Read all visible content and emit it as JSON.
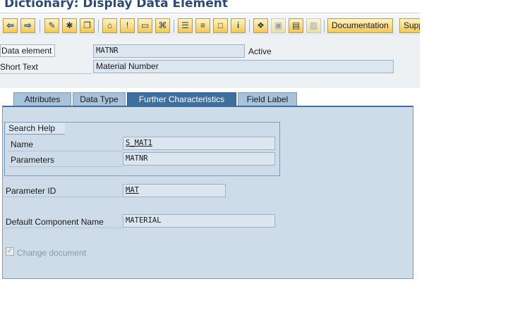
{
  "window": {
    "title": "Dictionary: Display Data Element"
  },
  "toolbar": {
    "back_icon": "arrow-left-icon",
    "forward_icon": "arrow-right-icon",
    "buttons": [
      "✎",
      "✱",
      "❐",
      "⌂",
      "!",
      "▭",
      "⌘",
      "☰",
      "≡",
      "□",
      "i",
      "❖",
      "▣",
      "▤",
      "▥"
    ],
    "documentation_label": "Documentation",
    "supp_label": "Supp"
  },
  "header": {
    "data_element_label": "Data element",
    "data_element_value": "MATNR",
    "status": "Active",
    "short_text_label": "Short Text",
    "short_text_value": "Material Number"
  },
  "tabs": [
    {
      "label": "Attributes"
    },
    {
      "label": "Data Type"
    },
    {
      "label": "Further Characteristics"
    },
    {
      "label": "Field Label"
    }
  ],
  "search_help": {
    "title": "Search Help",
    "name_label": "Name",
    "name_value": "S_MAT1",
    "parameters_label": "Parameters",
    "parameters_value": "MATNR"
  },
  "parameter_id": {
    "label": "Parameter ID",
    "value": "MAT"
  },
  "default_component": {
    "label": "Default Component Name",
    "value": "MATERIAL"
  },
  "change_document": {
    "label": "Change document",
    "checked": true
  },
  "colors": {
    "active_tab": "#3f6f9e",
    "panel": "#cedbe8",
    "field": "#dce6f0",
    "title": "#2c4a72"
  }
}
